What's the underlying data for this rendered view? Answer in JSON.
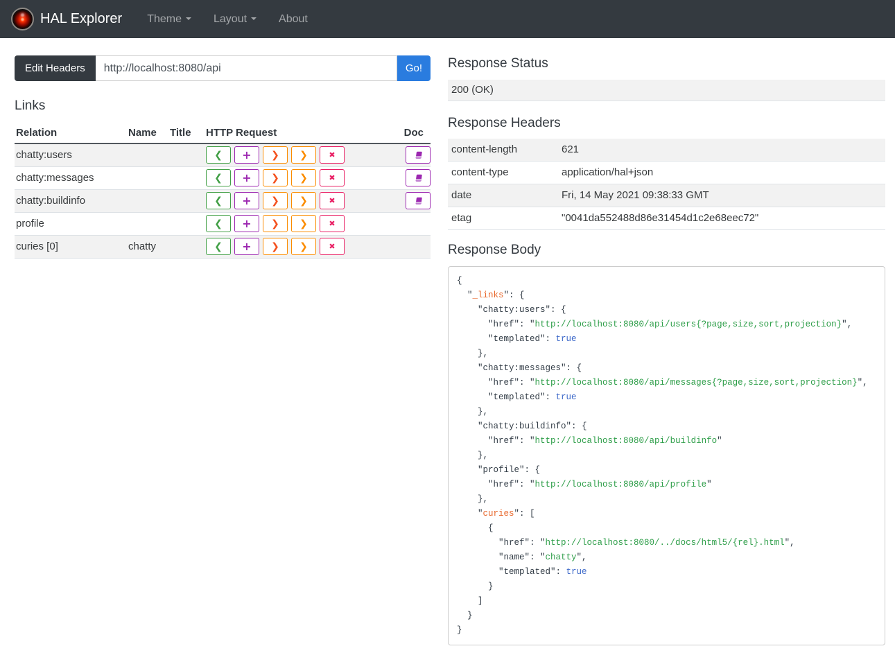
{
  "navbar": {
    "brand": "HAL Explorer",
    "theme_label": "Theme",
    "layout_label": "Layout",
    "about_label": "About"
  },
  "request_bar": {
    "edit_headers_label": "Edit Headers",
    "url_value": "http://localhost:8080/api",
    "go_label": "Go!"
  },
  "links": {
    "heading": "Links",
    "columns": {
      "relation": "Relation",
      "name": "Name",
      "title": "Title",
      "http_request": "HTTP Request",
      "doc": "Doc"
    },
    "http_buttons": [
      {
        "method": "get",
        "glyph": "❮",
        "color": "#43a047"
      },
      {
        "method": "post",
        "glyph": "+",
        "color": "#9c27b0"
      },
      {
        "method": "put",
        "glyph": "❯",
        "color": "#f4511e"
      },
      {
        "method": "patch",
        "glyph": "❯",
        "color": "#fb8c00"
      },
      {
        "method": "delete",
        "glyph": "✖",
        "color": "#e91e63"
      }
    ],
    "rows": [
      {
        "relation": "chatty:users",
        "name": "",
        "title": "",
        "doc": true
      },
      {
        "relation": "chatty:messages",
        "name": "",
        "title": "",
        "doc": true
      },
      {
        "relation": "chatty:buildinfo",
        "name": "",
        "title": "",
        "doc": true
      },
      {
        "relation": "profile",
        "name": "",
        "title": "",
        "doc": false
      },
      {
        "relation": "curies [0]",
        "name": "chatty",
        "title": "",
        "doc": false
      }
    ]
  },
  "response_status": {
    "heading": "Response Status",
    "value": "200 (OK)"
  },
  "response_headers": {
    "heading": "Response Headers",
    "rows": [
      {
        "name": "content-length",
        "value": "621"
      },
      {
        "name": "content-type",
        "value": "application/hal+json"
      },
      {
        "name": "date",
        "value": "Fri, 14 May 2021 09:38:33 GMT"
      },
      {
        "name": "etag",
        "value": "\"0041da552488d86e31454d1c2e68eec72\""
      }
    ]
  },
  "response_body": {
    "heading": "Response Body",
    "lines": [
      [
        [
          "p",
          "{"
        ]
      ],
      [
        [
          "p",
          "  \""
        ],
        [
          "h",
          "_links"
        ],
        [
          "p",
          "\": {"
        ]
      ],
      [
        [
          "p",
          "    \"chatty:users\": {"
        ]
      ],
      [
        [
          "p",
          "      \"href\": \""
        ],
        [
          "s",
          "http://localhost:8080/api/users{?page,size,sort,projection}"
        ],
        [
          "p",
          "\","
        ]
      ],
      [
        [
          "p",
          "      \"templated\": "
        ],
        [
          "b",
          "true"
        ]
      ],
      [
        [
          "p",
          "    },"
        ]
      ],
      [
        [
          "p",
          "    \"chatty:messages\": {"
        ]
      ],
      [
        [
          "p",
          "      \"href\": \""
        ],
        [
          "s",
          "http://localhost:8080/api/messages{?page,size,sort,projection}"
        ],
        [
          "p",
          "\","
        ]
      ],
      [
        [
          "p",
          "      \"templated\": "
        ],
        [
          "b",
          "true"
        ]
      ],
      [
        [
          "p",
          "    },"
        ]
      ],
      [
        [
          "p",
          "    \"chatty:buildinfo\": {"
        ]
      ],
      [
        [
          "p",
          "      \"href\": \""
        ],
        [
          "s",
          "http://localhost:8080/api/buildinfo"
        ],
        [
          "p",
          "\""
        ]
      ],
      [
        [
          "p",
          "    },"
        ]
      ],
      [
        [
          "p",
          "    \"profile\": {"
        ]
      ],
      [
        [
          "p",
          "      \"href\": \""
        ],
        [
          "s",
          "http://localhost:8080/api/profile"
        ],
        [
          "p",
          "\""
        ]
      ],
      [
        [
          "p",
          "    },"
        ]
      ],
      [
        [
          "p",
          "    \""
        ],
        [
          "h",
          "curies"
        ],
        [
          "p",
          "\": ["
        ]
      ],
      [
        [
          "p",
          "      {"
        ]
      ],
      [
        [
          "p",
          "        \"href\": \""
        ],
        [
          "s",
          "http://localhost:8080/../docs/html5/{rel}.html"
        ],
        [
          "p",
          "\","
        ]
      ],
      [
        [
          "p",
          "        \"name\": \""
        ],
        [
          "s",
          "chatty"
        ],
        [
          "p",
          "\","
        ]
      ],
      [
        [
          "p",
          "        \"templated\": "
        ],
        [
          "b",
          "true"
        ]
      ],
      [
        [
          "p",
          "      }"
        ]
      ],
      [
        [
          "p",
          "    ]"
        ]
      ],
      [
        [
          "p",
          "  }"
        ]
      ],
      [
        [
          "p",
          "}"
        ]
      ]
    ]
  },
  "colors": {
    "navbar_bg": "#343a40",
    "accent_blue": "#2a7cdf",
    "get_green": "#43a047",
    "post_purple": "#9c27b0",
    "put_orange": "#f4511e",
    "patch_orange": "#fb8c00",
    "delete_red": "#e91e63",
    "doc_purple": "#9c27b0",
    "stripe_gray": "#f2f2f2",
    "code_plain": "#333d47",
    "code_key_orange": "#e8682c",
    "code_string_green": "#2e9e49",
    "code_bool_blue": "#3d69c9"
  }
}
